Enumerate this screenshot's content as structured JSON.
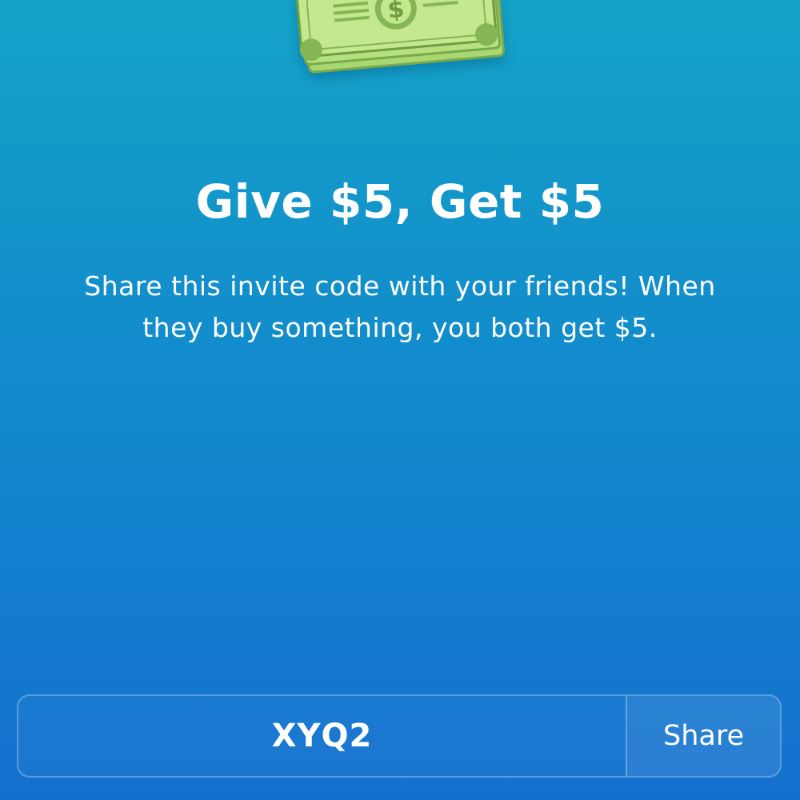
{
  "hero": {
    "icon": "money-stack-icon",
    "title": "Give $5, Get $5",
    "description_line1": "Share this invite code with your friends! When",
    "description_line2": "they buy something, you both get $5."
  },
  "invite": {
    "code": "XYQ2",
    "share_label": "Share"
  },
  "colors": {
    "background_top": "#14a3c7",
    "background_bottom": "#1470cf",
    "bill_light": "#bfe78a",
    "bill_dark": "#6e9e3e"
  }
}
